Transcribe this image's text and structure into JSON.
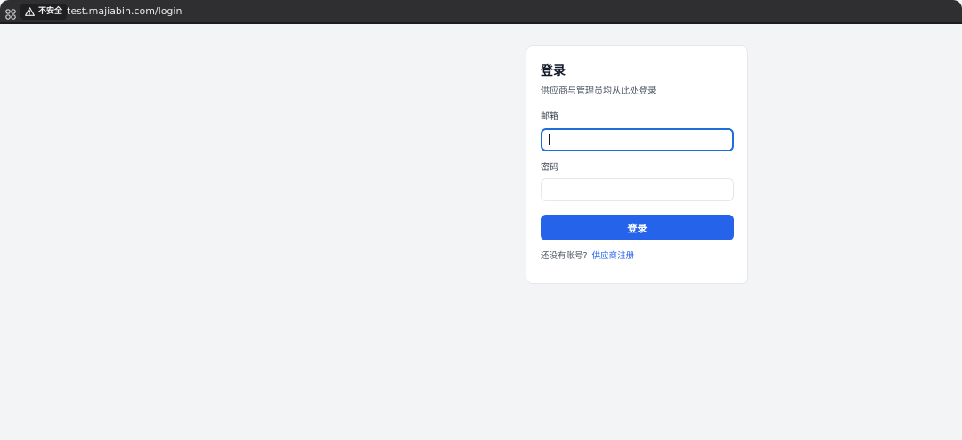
{
  "browser": {
    "security_label": "不安全",
    "url": "test.majiabin.com/login"
  },
  "login": {
    "title": "登录",
    "subtitle": "供应商与管理员均从此处登录",
    "email_label": "邮箱",
    "email_value": "",
    "password_label": "密码",
    "password_value": "",
    "submit_label": "登录",
    "no_account_text": "还没有账号?",
    "register_link": "供应商注册"
  },
  "colors": {
    "primary": "#2563eb",
    "focus_border": "#1e6fd9",
    "page_bg": "#f3f4f6",
    "card_bg": "#ffffff",
    "toolbar_bg": "#2f2f31"
  }
}
